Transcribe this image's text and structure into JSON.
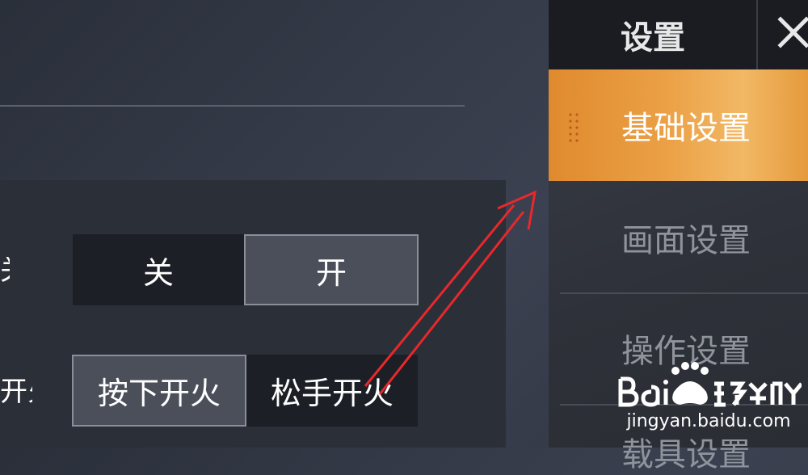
{
  "settings_rows": [
    {
      "label": "关闭",
      "options": [
        "关",
        "开"
      ],
      "selected": "开"
    },
    {
      "label": "开火方式",
      "options": [
        "按下开火",
        "松手开火"
      ],
      "selected": "按下开火"
    }
  ],
  "menu": {
    "title": "设置",
    "items": [
      {
        "label": "基础设置",
        "active": true
      },
      {
        "label": "画面设置",
        "active": false
      },
      {
        "label": "操作设置",
        "active": false
      },
      {
        "label": "载具设置",
        "active": false
      }
    ]
  },
  "watermark": {
    "brand_text": "Bai百度经验",
    "url": "jingyan.baidu.com"
  },
  "icons": {
    "close": "close-icon",
    "grip": "drag-grip-icon",
    "arrow": "annotation-arrow"
  },
  "colors": {
    "accent": "#eba045",
    "panel": "#2b2f38",
    "arrow": "#e8282b",
    "selected_option": "#4a4f5a"
  }
}
